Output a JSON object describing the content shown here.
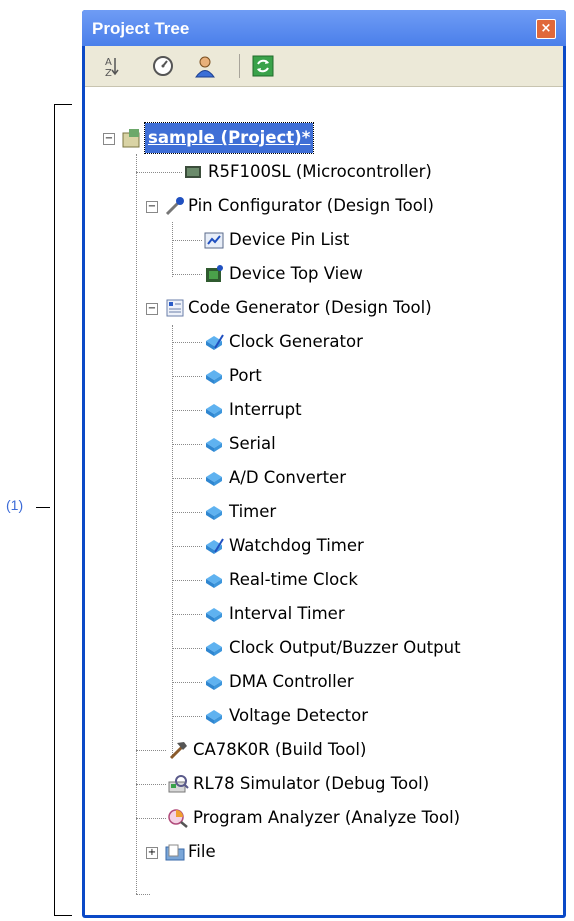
{
  "annotation": {
    "label": "(1)"
  },
  "panel": {
    "title": "Project Tree",
    "close_glyph": "×"
  },
  "toolbar": {
    "buttons": [
      {
        "name": "sort-az-icon"
      },
      {
        "name": "property-gauge-icon"
      },
      {
        "name": "user-icon"
      },
      {
        "name": "refresh-icon"
      }
    ]
  },
  "tree": {
    "root": "sample (Project)*",
    "microcontroller": "R5F100SL (Microcontroller)",
    "pin_configurator": "Pin Configurator (Design Tool)",
    "device_pin_list": "Device Pin List",
    "device_top_view": "Device Top View",
    "code_generator": "Code Generator (Design Tool)",
    "cg_items": [
      "Clock Generator",
      "Port",
      "Interrupt",
      "Serial",
      "A/D Converter",
      "Timer",
      "Watchdog Timer",
      "Real-time Clock",
      "Interval Timer",
      "Clock Output/Buzzer Output",
      "DMA Controller",
      "Voltage Detector"
    ],
    "build_tool": "CA78K0R (Build Tool)",
    "debug_tool": "RL78 Simulator (Debug Tool)",
    "analyze_tool": "Program Analyzer (Analyze Tool)",
    "file": "File"
  }
}
